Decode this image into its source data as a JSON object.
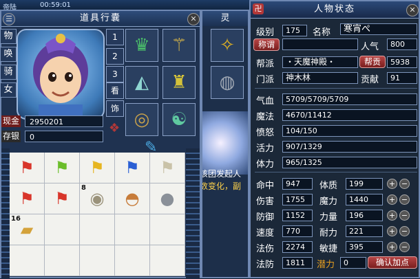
{
  "top_strip": {
    "left_text": "帝陆",
    "time": "00:59:01"
  },
  "inventory": {
    "title": "道具行囊",
    "side_tabs": [
      "物",
      "唤",
      "骑",
      "女"
    ],
    "num_tabs": [
      "1",
      "2",
      "3",
      "看",
      "饰"
    ],
    "cash_label": "现金",
    "cash_value": "2950201",
    "savings_label": "存银",
    "savings_value": "0",
    "equip_icons": [
      "helmet-icon",
      "scepter-icon",
      "fan-icon",
      "armor-icon",
      "belt-icon",
      "boots-icon"
    ],
    "grid": [
      {
        "icon": "red-flag-icon",
        "color": "#d8352a"
      },
      {
        "icon": "green-flag-icon",
        "color": "#6bbd2a"
      },
      {
        "icon": "yellow-flag-icon",
        "color": "#e6b520"
      },
      {
        "icon": "blue-flag-icon",
        "color": "#2a5fd4"
      },
      {
        "icon": "white-flag-icon",
        "color": "#e8e3cf"
      },
      {
        "icon": "red-flag-icon",
        "color": "#d8352a"
      },
      {
        "icon": "red-flag-icon",
        "color": "#d8352a"
      },
      {
        "icon": "shell-icon",
        "color": "#b8b096",
        "count": "8"
      },
      {
        "icon": "bowl-icon",
        "color": "#c77c3a"
      },
      {
        "icon": "orb-icon",
        "color": "#aab0b8"
      },
      {
        "icon": "book-icon",
        "color": "#d4a23a",
        "count": "16"
      }
    ]
  },
  "middle_window": {
    "title": "灵",
    "text_line1": "该团发起人",
    "text_line2": "数变化，副"
  },
  "status": {
    "title": "人物状态",
    "level_label": "级别",
    "level": "175",
    "name_label": "名称",
    "name": "寒宵ぺ",
    "title_btn": "称谓",
    "popularity_label": "人气",
    "popularity": "800",
    "faction_label": "帮派",
    "faction": "・天魔神殿・",
    "faction_contrib_btn": "帮贡",
    "faction_contrib": "5938",
    "sect_label": "门派",
    "sect": "神木林",
    "contrib_label": "贡献",
    "contrib": "91",
    "hp_label": "气血",
    "hp": "5709/5709/5709",
    "mp_label": "魔法",
    "mp": "4670/11412",
    "anger_label": "愤怒",
    "anger": "104/150",
    "vitality_label": "活力",
    "vitality": "907/1329",
    "stamina_label": "体力",
    "stamina": "965/1325",
    "stats": [
      {
        "left_label": "命中",
        "left_value": "947",
        "right_label": "体质",
        "right_value": "199"
      },
      {
        "left_label": "伤害",
        "left_value": "1755",
        "right_label": "魔力",
        "right_value": "1440"
      },
      {
        "left_label": "防御",
        "left_value": "1152",
        "right_label": "力量",
        "right_value": "196"
      },
      {
        "left_label": "速度",
        "left_value": "770",
        "right_label": "耐力",
        "right_value": "221"
      },
      {
        "left_label": "法伤",
        "left_value": "2274",
        "right_label": "敏捷",
        "right_value": "395"
      }
    ],
    "mdef_label": "法防",
    "mdef": "1811",
    "potential_label": "潜力",
    "potential": "0",
    "confirm_btn": "确认加点",
    "colors": {
      "label_red": "#7a1e1e",
      "potential": "#e8a020"
    }
  }
}
